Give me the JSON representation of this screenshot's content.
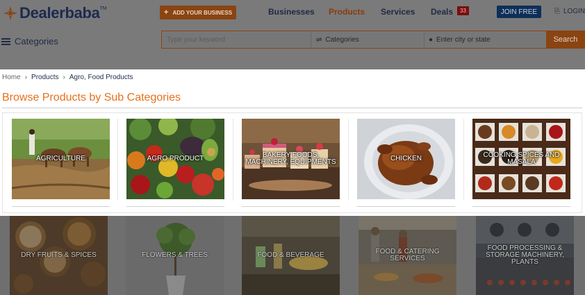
{
  "header": {
    "logo_text": "Dealerbaba",
    "logo_tm": "TM",
    "add_business": "ADD YOUR BUSINESS",
    "nav": [
      {
        "label": "Businesses",
        "active": false
      },
      {
        "label": "Products",
        "active": true
      },
      {
        "label": "Services",
        "active": false
      },
      {
        "label": "Deals",
        "active": false
      }
    ],
    "deals_count": "33",
    "join": "JOIN FREE",
    "login": "LOGIN"
  },
  "categories_menu": "Categories",
  "search": {
    "keyword_placeholder": "Type your keyword",
    "category_label": "Categories",
    "location_placeholder": "Enter city or state",
    "button": "Search"
  },
  "breadcrumb": {
    "home": "Home",
    "items": [
      "Products",
      "Agro, Food Products"
    ]
  },
  "panel_title": "Browse Products by Sub Categories",
  "subcategories": [
    {
      "label": "AGRICULTURE",
      "icon": "agriculture-image"
    },
    {
      "label": "AGRO PRODUCT",
      "icon": "vegetables-image"
    },
    {
      "label": "BAKERY FOODS, MACHINERY, EQUIPMENTS",
      "icon": "bakery-image"
    },
    {
      "label": "CHICKEN",
      "icon": "chicken-image"
    },
    {
      "label": "COOKING SPICES AND MASALA",
      "icon": "spices-image"
    }
  ],
  "background_categories": [
    {
      "label": "DRY FRUITS & SPICES"
    },
    {
      "label": "FLOWERS & TREES"
    },
    {
      "label": "FOOD & BEVERAGE"
    },
    {
      "label": "FOOD & CATERING SERVICES"
    },
    {
      "label": "FOOD PROCESSING & STORAGE MACHINERY, PLANTS"
    }
  ],
  "colors": {
    "accent": "#e8701a",
    "navy": "#1e2a45",
    "overlay": "#6f6f6f"
  }
}
